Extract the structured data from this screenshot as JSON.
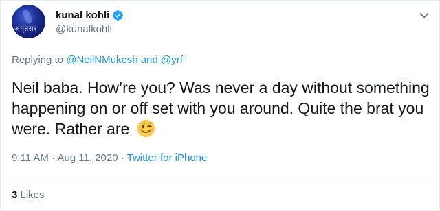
{
  "author": {
    "name": "kunal kohli",
    "handle": "@kunalkohli",
    "avatar_text": "अमृतसर",
    "verified_icon": "verified-badge-icon"
  },
  "reply": {
    "prefix": "Replying to ",
    "user1": "@NeilNMukesh",
    "joiner": " and ",
    "user2": "@yrf"
  },
  "tweet": {
    "text": "Neil baba. How’re you? Was never a day without something happening on or off set with you around. Quite the brat you were. Rather are",
    "emoji": "winking-face-emoji"
  },
  "meta": {
    "time": "9:11 AM",
    "separator1": " · ",
    "date": "Aug 11, 2020",
    "separator2": " · ",
    "source": "Twitter for iPhone"
  },
  "stats": {
    "likes_count": "3",
    "likes_label": " Likes"
  },
  "menu": {
    "icon": "chevron-down-icon"
  },
  "colors": {
    "link": "#1b95e0",
    "secondary": "#657786",
    "primary_text": "#14171a",
    "verified": "#1da1f2",
    "divider": "#e6ecf0"
  }
}
